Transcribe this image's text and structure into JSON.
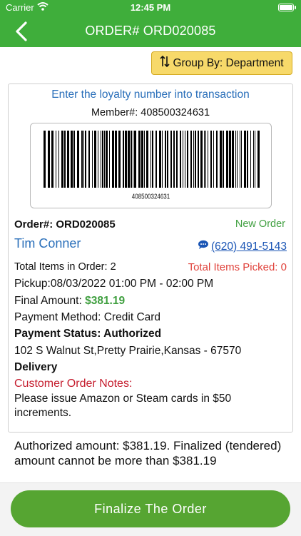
{
  "status_bar": {
    "carrier": "Carrier",
    "time": "12:45 PM"
  },
  "nav": {
    "title": "ORDER# ORD020085",
    "back_icon": "chevron-left-icon"
  },
  "group_by": {
    "label": "Group By: Department",
    "icon": "sort-arrows-icon"
  },
  "card": {
    "hint": "Enter the  loyalty number into transaction",
    "member": "Member#: 408500324631",
    "barcode_text": "408500324631",
    "order_number": "Order#: ORD020085",
    "order_status": "New Order",
    "customer_name": "Tim Conner",
    "phone": "(620) 491-5143",
    "total_items": "Total Items in Order: 2",
    "total_picked": "Total Items Picked: 0",
    "pickup": "Pickup:08/03/2022 01:00 PM - 02:00 PM",
    "final_label": "Final Amount: ",
    "final_amount": "$381.19",
    "payment_method": "Payment Method: Credit Card",
    "payment_status": "Payment Status: Authorized",
    "address": "102 S Walnut St,Pretty Prairie,Kansas - 67570",
    "delivery": "Delivery",
    "notes_label": "Customer Order Notes:",
    "notes": "Please issue Amazon or Steam cards in $50 increments."
  },
  "auth_message": "Authorized amount: $381.19. Finalized (tendered) amount cannot be more than $381.19",
  "finalize": {
    "label": "Finalize The Order"
  },
  "colors": {
    "accent_green": "#3fae3b",
    "button_green": "#56a532",
    "link_blue": "#2a6fba",
    "alert_red": "#e0413a",
    "notes_red": "#c51c2d",
    "group_yellow": "#f7d96a"
  }
}
